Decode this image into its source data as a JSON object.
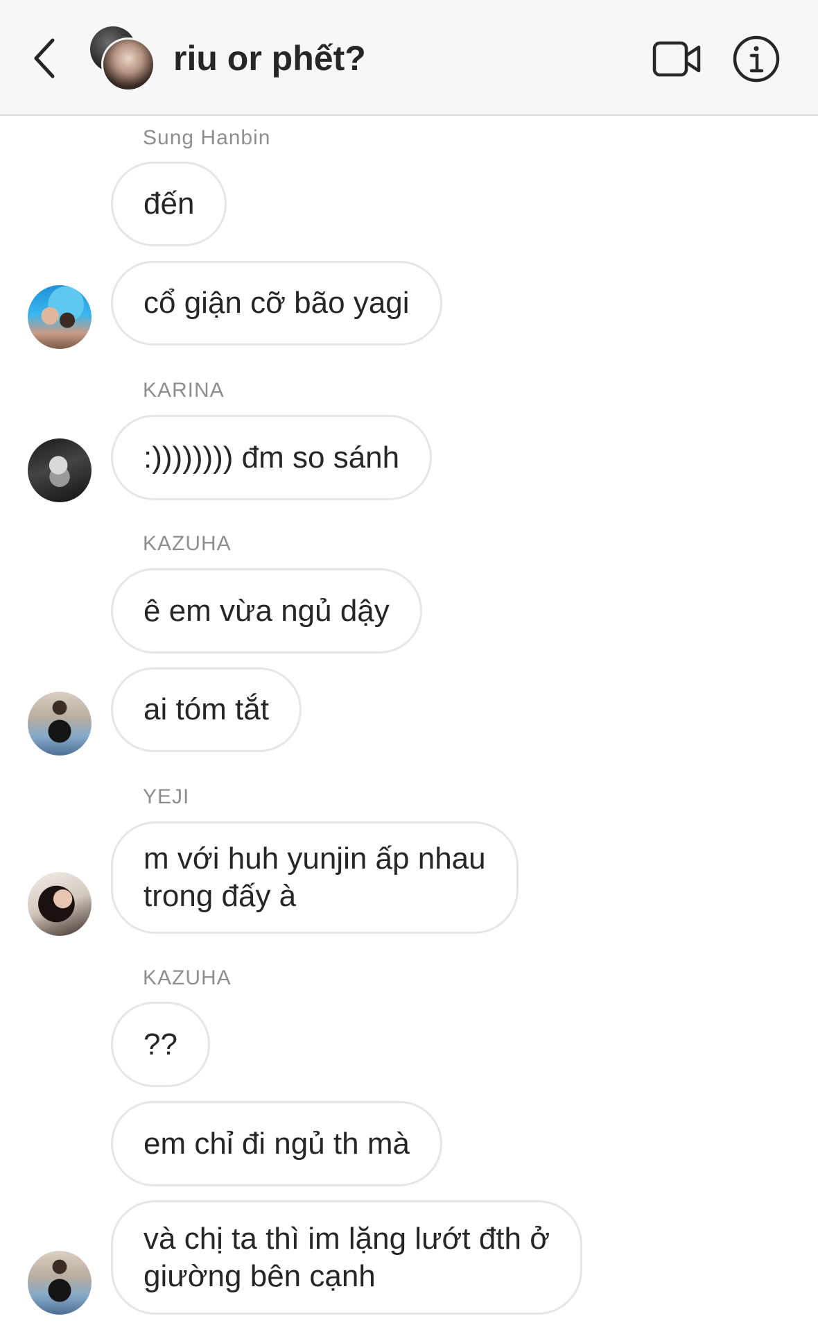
{
  "header": {
    "title": "riu or phết?",
    "back_icon": "chevron-left-icon",
    "video_icon": "video-camera-icon",
    "info_icon": "info-icon"
  },
  "messages": [
    {
      "type": "sender",
      "text": "Sung Hanbin"
    },
    {
      "type": "bubble",
      "text": "đến"
    },
    {
      "type": "bubble",
      "text": "cổ giận cỡ bão yagi"
    },
    {
      "type": "sender",
      "text": "KARINA"
    },
    {
      "type": "bubble",
      "text": ":)))))))) đm so sánh"
    },
    {
      "type": "sender",
      "text": "KAZUHA"
    },
    {
      "type": "bubble",
      "text": "ê em vừa ngủ dậy"
    },
    {
      "type": "bubble",
      "text": "ai tóm tắt"
    },
    {
      "type": "sender",
      "text": "YEJI"
    },
    {
      "type": "bubble",
      "text": "m với huh yunjin ấp nhau\ntrong đấy à"
    },
    {
      "type": "sender",
      "text": "KAZUHA"
    },
    {
      "type": "bubble",
      "text": "??"
    },
    {
      "type": "bubble",
      "text": "em chỉ đi ngủ th mà"
    },
    {
      "type": "bubble",
      "text": "và chị ta thì im lặng lướt đth ở\ngiường bên cạnh"
    }
  ]
}
